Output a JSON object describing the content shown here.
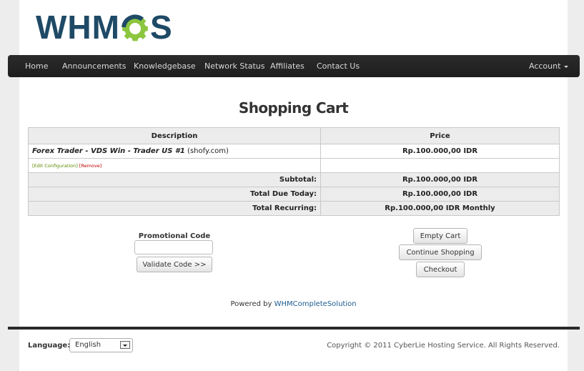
{
  "header": {
    "logo_left": "WHM",
    "logo_right": "S",
    "colors": {
      "logo_text": "#1f4a66",
      "logo_gear": "#8cc63f",
      "navbar": "#222222"
    }
  },
  "nav": {
    "items": [
      "Home",
      "Announcements",
      "Knowledgebase",
      "Network Status",
      "Affiliates",
      "Contact Us"
    ],
    "account": "Account"
  },
  "page_title": "Shopping Cart",
  "cart": {
    "headers": {
      "description": "Description",
      "price": "Price"
    },
    "item": {
      "name": "Forex Trader - VDS Win - Trader US #1",
      "domain": "(shofy.com)",
      "price": "Rp.100.000,00 IDR",
      "edit_label": "[Edit Configuration]",
      "remove_label": "[Remove]"
    },
    "subtotal_label": "Subtotal:",
    "subtotal": "Rp.100.000,00 IDR",
    "due_today_label": "Total Due Today:",
    "due_today": "Rp.100.000,00 IDR",
    "recurring_label": "Total Recurring:",
    "recurring": "Rp.100.000,00 IDR Monthly"
  },
  "promo": {
    "label": "Promotional Code",
    "value": "",
    "validate_button": "Validate Code >>"
  },
  "actions": {
    "empty_cart": "Empty Cart",
    "continue_shopping": "Continue Shopping",
    "checkout": "Checkout"
  },
  "powered": {
    "prefix": "Powered by",
    "link": "WHMCompleteSolution"
  },
  "footer": {
    "language_label": "Language:",
    "language_selected": "English",
    "copyright": "Copyright © 2011 CyberLie Hosting Service. All Rights Reserved."
  }
}
